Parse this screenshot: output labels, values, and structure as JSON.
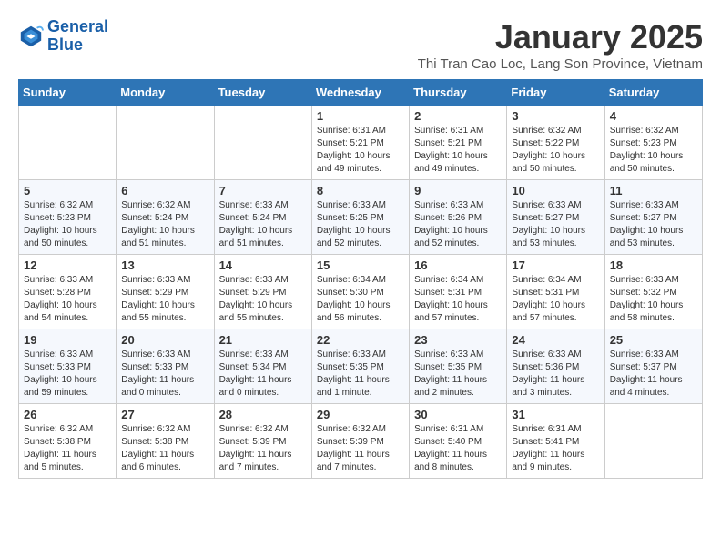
{
  "header": {
    "logo_line1": "General",
    "logo_line2": "Blue",
    "month_year": "January 2025",
    "location": "Thi Tran Cao Loc, Lang Son Province, Vietnam"
  },
  "weekdays": [
    "Sunday",
    "Monday",
    "Tuesday",
    "Wednesday",
    "Thursday",
    "Friday",
    "Saturday"
  ],
  "weeks": [
    [
      {
        "day": "",
        "sunrise": "",
        "sunset": "",
        "daylight": ""
      },
      {
        "day": "",
        "sunrise": "",
        "sunset": "",
        "daylight": ""
      },
      {
        "day": "",
        "sunrise": "",
        "sunset": "",
        "daylight": ""
      },
      {
        "day": "1",
        "sunrise": "Sunrise: 6:31 AM",
        "sunset": "Sunset: 5:21 PM",
        "daylight": "Daylight: 10 hours and 49 minutes."
      },
      {
        "day": "2",
        "sunrise": "Sunrise: 6:31 AM",
        "sunset": "Sunset: 5:21 PM",
        "daylight": "Daylight: 10 hours and 49 minutes."
      },
      {
        "day": "3",
        "sunrise": "Sunrise: 6:32 AM",
        "sunset": "Sunset: 5:22 PM",
        "daylight": "Daylight: 10 hours and 50 minutes."
      },
      {
        "day": "4",
        "sunrise": "Sunrise: 6:32 AM",
        "sunset": "Sunset: 5:23 PM",
        "daylight": "Daylight: 10 hours and 50 minutes."
      }
    ],
    [
      {
        "day": "5",
        "sunrise": "Sunrise: 6:32 AM",
        "sunset": "Sunset: 5:23 PM",
        "daylight": "Daylight: 10 hours and 50 minutes."
      },
      {
        "day": "6",
        "sunrise": "Sunrise: 6:32 AM",
        "sunset": "Sunset: 5:24 PM",
        "daylight": "Daylight: 10 hours and 51 minutes."
      },
      {
        "day": "7",
        "sunrise": "Sunrise: 6:33 AM",
        "sunset": "Sunset: 5:24 PM",
        "daylight": "Daylight: 10 hours and 51 minutes."
      },
      {
        "day": "8",
        "sunrise": "Sunrise: 6:33 AM",
        "sunset": "Sunset: 5:25 PM",
        "daylight": "Daylight: 10 hours and 52 minutes."
      },
      {
        "day": "9",
        "sunrise": "Sunrise: 6:33 AM",
        "sunset": "Sunset: 5:26 PM",
        "daylight": "Daylight: 10 hours and 52 minutes."
      },
      {
        "day": "10",
        "sunrise": "Sunrise: 6:33 AM",
        "sunset": "Sunset: 5:27 PM",
        "daylight": "Daylight: 10 hours and 53 minutes."
      },
      {
        "day": "11",
        "sunrise": "Sunrise: 6:33 AM",
        "sunset": "Sunset: 5:27 PM",
        "daylight": "Daylight: 10 hours and 53 minutes."
      }
    ],
    [
      {
        "day": "12",
        "sunrise": "Sunrise: 6:33 AM",
        "sunset": "Sunset: 5:28 PM",
        "daylight": "Daylight: 10 hours and 54 minutes."
      },
      {
        "day": "13",
        "sunrise": "Sunrise: 6:33 AM",
        "sunset": "Sunset: 5:29 PM",
        "daylight": "Daylight: 10 hours and 55 minutes."
      },
      {
        "day": "14",
        "sunrise": "Sunrise: 6:33 AM",
        "sunset": "Sunset: 5:29 PM",
        "daylight": "Daylight: 10 hours and 55 minutes."
      },
      {
        "day": "15",
        "sunrise": "Sunrise: 6:34 AM",
        "sunset": "Sunset: 5:30 PM",
        "daylight": "Daylight: 10 hours and 56 minutes."
      },
      {
        "day": "16",
        "sunrise": "Sunrise: 6:34 AM",
        "sunset": "Sunset: 5:31 PM",
        "daylight": "Daylight: 10 hours and 57 minutes."
      },
      {
        "day": "17",
        "sunrise": "Sunrise: 6:34 AM",
        "sunset": "Sunset: 5:31 PM",
        "daylight": "Daylight: 10 hours and 57 minutes."
      },
      {
        "day": "18",
        "sunrise": "Sunrise: 6:33 AM",
        "sunset": "Sunset: 5:32 PM",
        "daylight": "Daylight: 10 hours and 58 minutes."
      }
    ],
    [
      {
        "day": "19",
        "sunrise": "Sunrise: 6:33 AM",
        "sunset": "Sunset: 5:33 PM",
        "daylight": "Daylight: 10 hours and 59 minutes."
      },
      {
        "day": "20",
        "sunrise": "Sunrise: 6:33 AM",
        "sunset": "Sunset: 5:33 PM",
        "daylight": "Daylight: 11 hours and 0 minutes."
      },
      {
        "day": "21",
        "sunrise": "Sunrise: 6:33 AM",
        "sunset": "Sunset: 5:34 PM",
        "daylight": "Daylight: 11 hours and 0 minutes."
      },
      {
        "day": "22",
        "sunrise": "Sunrise: 6:33 AM",
        "sunset": "Sunset: 5:35 PM",
        "daylight": "Daylight: 11 hours and 1 minute."
      },
      {
        "day": "23",
        "sunrise": "Sunrise: 6:33 AM",
        "sunset": "Sunset: 5:35 PM",
        "daylight": "Daylight: 11 hours and 2 minutes."
      },
      {
        "day": "24",
        "sunrise": "Sunrise: 6:33 AM",
        "sunset": "Sunset: 5:36 PM",
        "daylight": "Daylight: 11 hours and 3 minutes."
      },
      {
        "day": "25",
        "sunrise": "Sunrise: 6:33 AM",
        "sunset": "Sunset: 5:37 PM",
        "daylight": "Daylight: 11 hours and 4 minutes."
      }
    ],
    [
      {
        "day": "26",
        "sunrise": "Sunrise: 6:32 AM",
        "sunset": "Sunset: 5:38 PM",
        "daylight": "Daylight: 11 hours and 5 minutes."
      },
      {
        "day": "27",
        "sunrise": "Sunrise: 6:32 AM",
        "sunset": "Sunset: 5:38 PM",
        "daylight": "Daylight: 11 hours and 6 minutes."
      },
      {
        "day": "28",
        "sunrise": "Sunrise: 6:32 AM",
        "sunset": "Sunset: 5:39 PM",
        "daylight": "Daylight: 11 hours and 7 minutes."
      },
      {
        "day": "29",
        "sunrise": "Sunrise: 6:32 AM",
        "sunset": "Sunset: 5:39 PM",
        "daylight": "Daylight: 11 hours and 7 minutes."
      },
      {
        "day": "30",
        "sunrise": "Sunrise: 6:31 AM",
        "sunset": "Sunset: 5:40 PM",
        "daylight": "Daylight: 11 hours and 8 minutes."
      },
      {
        "day": "31",
        "sunrise": "Sunrise: 6:31 AM",
        "sunset": "Sunset: 5:41 PM",
        "daylight": "Daylight: 11 hours and 9 minutes."
      },
      {
        "day": "",
        "sunrise": "",
        "sunset": "",
        "daylight": ""
      }
    ]
  ]
}
